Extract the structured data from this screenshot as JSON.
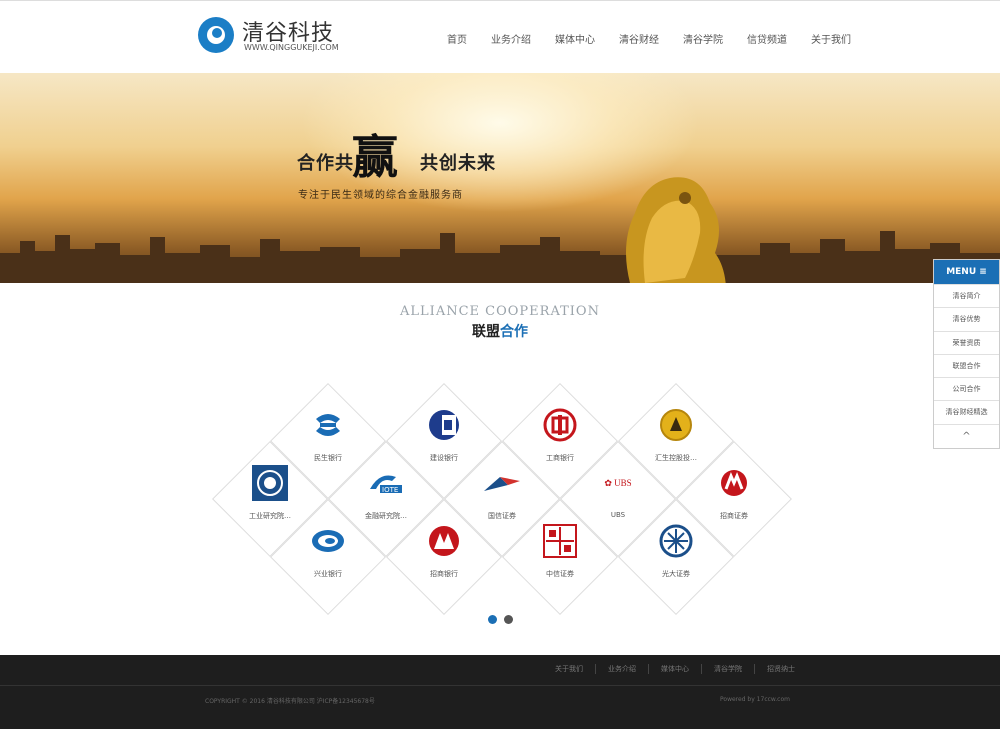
{
  "header": {
    "logo_name": "清谷科技",
    "logo_sub": "WWW.QINGGUKEJI.COM",
    "nav": [
      "首页",
      "业务介绍",
      "媒体中心",
      "清谷财经",
      "清谷学院",
      "信贷频道",
      "关于我们"
    ]
  },
  "banner": {
    "slogan_left": "合作共",
    "slogan_big": "赢",
    "slogan_right": "共创未来",
    "subtitle": "专注于民生领域的综合金融服务商"
  },
  "side_menu": {
    "head": "MENU ≡",
    "items": [
      "清谷简介",
      "清谷优势",
      "荣誉资质",
      "联盟合作",
      "公司合作",
      "清谷财经精选"
    ],
    "up": "^"
  },
  "section": {
    "title_en": "ALLIANCE COOPERATION",
    "title_cn_a": "联盟",
    "title_cn_b": "合作"
  },
  "partners": [
    {
      "name": "民生银行",
      "icon": "minsheng-bank-icon",
      "color": "#1a6cb5"
    },
    {
      "name": "建设银行",
      "icon": "ccb-icon",
      "color": "#1e3c8c"
    },
    {
      "name": "工商银行",
      "icon": "icbc-icon",
      "color": "#c4161c"
    },
    {
      "name": "汇生控股投…",
      "icon": "gold-emblem-icon",
      "color": "#e3b11a"
    },
    {
      "name": "工业研究院…",
      "icon": "institute-seal-icon",
      "color": "#1b4f8a"
    },
    {
      "name": "金融研究院…",
      "icon": "iote-icon",
      "color": "#1a6cb5"
    },
    {
      "name": "国信证券",
      "icon": "guosen-icon",
      "color": "#d2322d"
    },
    {
      "name": "UBS",
      "icon": "ubs-icon",
      "color": "#c4161c"
    },
    {
      "name": "招商证券",
      "icon": "cms-sec-icon",
      "color": "#c4161c"
    },
    {
      "name": "兴业银行",
      "icon": "cib-icon",
      "color": "#1a6cb5"
    },
    {
      "name": "招商银行",
      "icon": "cmb-icon",
      "color": "#c4161c"
    },
    {
      "name": "中信证券",
      "icon": "citic-icon",
      "color": "#c4161c"
    },
    {
      "name": "光大证券",
      "icon": "everbright-icon",
      "color": "#1b4f8a"
    }
  ],
  "ubs_text": "✿ UBS",
  "carousel": {
    "pages": 2,
    "active": 1
  },
  "footer": {
    "links": [
      "关于我们",
      "业务介绍",
      "媒体中心",
      "清谷学院",
      "招贤纳士"
    ],
    "copyright": "COPYRIGHT © 2016  清谷科技有限公司  沪ICP备12345678号",
    "powered": "Powered by 17ccw.com"
  }
}
